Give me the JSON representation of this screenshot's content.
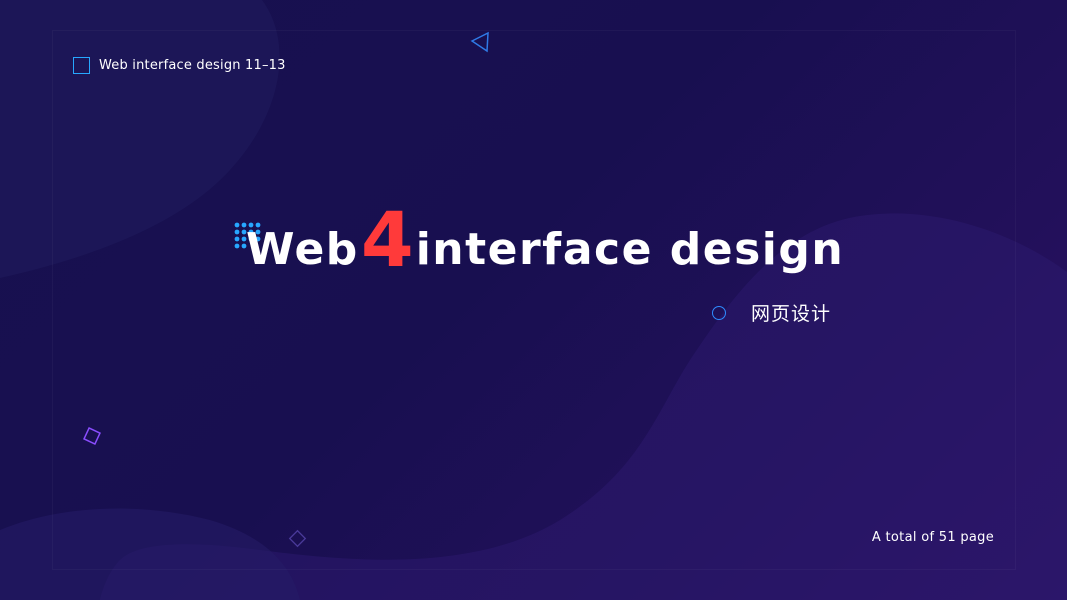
{
  "header": {
    "subtitle": "Web interface design 11–13"
  },
  "title": {
    "word_a": "Web",
    "accent": "4",
    "word_b": "interface design",
    "accent_color": "#ff3a3a"
  },
  "cn_subtitle": "网页设计",
  "footer": {
    "page_total": "A total of 51 page"
  },
  "colors": {
    "background": "#18104f",
    "accent_blue": "#27a7ff",
    "accent_purple": "#8a4dff"
  },
  "icons": {
    "header": "square-outline-icon",
    "title": "dot-grid-icon",
    "top": "triangle-outline-icon",
    "cn": "circle-outline-icon",
    "left": "diamond-outline-icon",
    "bottom": "diamond-outline-icon"
  }
}
